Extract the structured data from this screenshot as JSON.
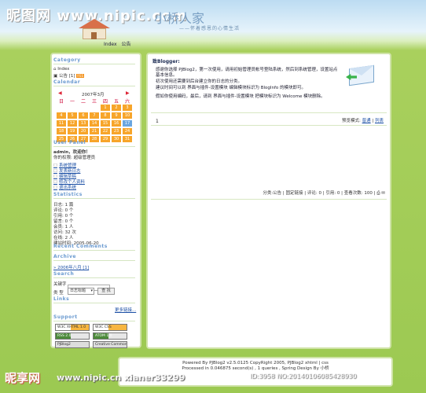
{
  "watermark": {
    "top": "昵图网 www.nipic.com",
    "bottom_logo": "昵享网",
    "bottom_url": "www.nipic.cn xianer33299",
    "bottom_id": "ID:3958 NO:20140106085428930"
  },
  "header": {
    "title": "小桥人家",
    "subtitle": "——怀着感恩的心情生活",
    "nav": [
      "Index",
      "公告"
    ]
  },
  "sidebar": {
    "category_title": "Category",
    "categories": [
      "Index",
      "公告 [1]"
    ],
    "calendar_title": "Calendar",
    "calendar": {
      "month_label": "2007年3月",
      "prev": "◀",
      "next": "▶",
      "weekdays": [
        "日",
        "一",
        "二",
        "三",
        "四",
        "五",
        "六"
      ],
      "days": [
        "",
        "",
        "",
        "",
        "1",
        "2",
        "3",
        "4",
        "5",
        "6",
        "7",
        "8",
        "9",
        "10",
        "11",
        "12",
        "13",
        "14",
        "15",
        "16",
        "17",
        "18",
        "19",
        "20",
        "21",
        "22",
        "23",
        "24",
        "25",
        "26",
        "27",
        "28",
        "29",
        "30",
        "31"
      ],
      "today": "17"
    },
    "user_panel_title": "User Panel",
    "user_greeting": "admin，欢迎你！",
    "user_role": "你的权限: 超级管理员",
    "user_links": [
      "系统管理",
      "发表新日志",
      "编辑草稿",
      "修改个人资料",
      "退出系统"
    ],
    "stats_title": "Statistics",
    "stats": [
      "日志: 1 篇",
      "评论: 0 个",
      "引用: 0 个",
      "留言: 0 个",
      "会员: 1 人",
      "访问: 32 次",
      "在线: 2 人",
      "建站时间: 2005-06-20"
    ],
    "recent_comments_title": "Recent Comments",
    "archive_title": "Archive",
    "archive_item": "2006年八月 [1]",
    "search_title": "Search",
    "search_keyword_label": "关键字",
    "search_type_label": "类 型",
    "search_type_value": "日志标题",
    "search_button": "查 找",
    "links_title": "Links",
    "links_more": "更多链接...",
    "support_title": "Support",
    "badges": [
      "W3C XHTML 1.0",
      "W3C CSS",
      "RSS 2.0",
      "ATOM 1.0",
      "PJBlog2",
      "Creative Commons"
    ]
  },
  "main": {
    "post_title": "致Blogger:",
    "paragraphs": [
      "感谢你选择 PJBlog2，第一次使用，请用初始管理员帐号登陆系统，然后到系统管理，设置站点基本信息。",
      "初次使用还需要到后台建立你的日志的分类。",
      "建议时间可以到 界面与插件-设置模块 编辑模块标识为 BlogInfo 的模块即可。",
      "假如你使用编码，最后，请到 界面与插件-设置模块 把模块标识为 Welcome 模块删除。"
    ],
    "page_number": "1",
    "view_mode_label": "预览模式:",
    "view_mode_normal": "普通",
    "view_mode_list": "列表",
    "meta": "分类:公告 | 固定链接 | 评论: 0 | 引用: 0 | 查看次数: 100 |"
  },
  "footer": {
    "line1": "Powered By PJBlog2 v2.5.0125 CopyRight 2005, PJBlog2 xhtml | css",
    "line2": "Processed in 0.046875 second(s) , 1 queries , Spring Design By 小桥"
  }
}
